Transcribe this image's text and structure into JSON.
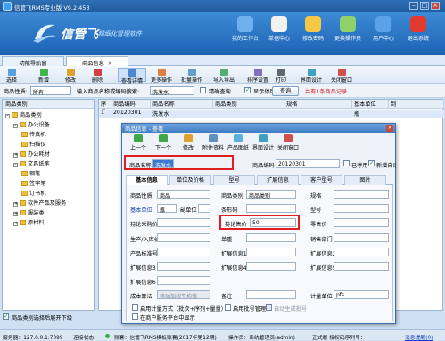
{
  "app": {
    "title": "信管飞RMS专业版 V9.2.453"
  },
  "banner": {
    "brand": "信管飞",
    "slogan": "精细化管理软件",
    "nav": [
      {
        "label": "我的工作台",
        "icon": "monitor-icon",
        "color": "#6fb1ee"
      },
      {
        "label": "单据中心",
        "icon": "document-center-icon",
        "color": "#f2f2f2"
      },
      {
        "label": "修改密码",
        "icon": "password-lock-icon",
        "color": "#f4c842"
      },
      {
        "label": "更换操作员",
        "icon": "switch-user-icon",
        "color": "#8fd16a"
      },
      {
        "label": "用户中心",
        "icon": "user-center-icon",
        "color": "#5aa2e8"
      },
      {
        "label": "退出系统",
        "icon": "power-icon",
        "color": "#e23b2e"
      }
    ]
  },
  "tabs": [
    {
      "label": "功能导航窗"
    },
    {
      "label": "商品信息"
    }
  ],
  "toolbar": [
    {
      "label": "选择",
      "icon": "select-icon",
      "color": "#58a0e0"
    },
    {
      "label": "新增",
      "icon": "add-icon",
      "color": "#3fb54a"
    },
    {
      "label": "修改",
      "icon": "edit-icon",
      "color": "#e0a030"
    },
    {
      "label": "删除",
      "icon": "delete-icon",
      "color": "#d04040"
    },
    {
      "label": "查看详情",
      "icon": "view-detail-icon",
      "color": "#4a88d0"
    },
    {
      "label": "更多操作",
      "icon": "more-actions-icon",
      "color": "#e08040"
    },
    {
      "label": "批量操作",
      "icon": "batch-icon",
      "color": "#60a0d0"
    },
    {
      "label": "导入导出",
      "icon": "import-export-icon",
      "color": "#50b070"
    },
    {
      "label": "排序设置",
      "icon": "sort-icon",
      "color": "#8070c0"
    },
    {
      "label": "打印",
      "icon": "print-icon",
      "color": "#606870"
    },
    {
      "label": "界面设计",
      "icon": "design-icon",
      "color": "#40a0c0"
    },
    {
      "label": "关闭窗口",
      "icon": "close-window-icon",
      "color": "#d05050"
    }
  ],
  "filter": {
    "field_label": "商品性质:",
    "field_value": "所有",
    "keyword_label": "输入商品名称或编码搜索:",
    "keyword_value": "洗发水",
    "fuzzy_label": "精确查询",
    "show_disabled_label": "显示停用商品",
    "query_button": "查询",
    "result_text": "共有1条商品记录"
  },
  "tree": {
    "header": "商品类别",
    "nodes": [
      {
        "label": "商品类别",
        "level": 0,
        "sign": "-"
      },
      {
        "label": "办公设备",
        "level": 1,
        "sign": "-"
      },
      {
        "label": "传真机",
        "level": 2,
        "sign": ""
      },
      {
        "label": "扫描仪",
        "level": 2,
        "sign": ""
      },
      {
        "label": "办公耗材",
        "level": 1,
        "sign": "+"
      },
      {
        "label": "文具纸笔",
        "level": 1,
        "sign": "-"
      },
      {
        "label": "钢笔",
        "level": 2,
        "sign": ""
      },
      {
        "label": "签字笔",
        "level": 2,
        "sign": ""
      },
      {
        "label": "订书机",
        "level": 2,
        "sign": ""
      },
      {
        "label": "软件产品及服务",
        "level": 1,
        "sign": "+"
      },
      {
        "label": "服装类",
        "level": 1,
        "sign": "+"
      },
      {
        "label": "原材料",
        "level": 1,
        "sign": "+"
      }
    ],
    "footer_checkbox": "商品类别选择后展开下级"
  },
  "grid": {
    "columns": [
      "序号",
      "商品编码",
      "商品名称",
      "商品类别",
      "规格",
      "基本单位",
      "到"
    ],
    "row": [
      "1",
      "20120301",
      "洗发水",
      "",
      "",
      "瓶",
      ""
    ]
  },
  "dialog": {
    "title": "商品信息 - 查看",
    "toolbar": [
      {
        "label": "上一个",
        "icon": "prev-icon",
        "color": "#3fa64a"
      },
      {
        "label": "下一个",
        "icon": "next-icon",
        "color": "#3fa64a"
      },
      {
        "label": "修改",
        "icon": "edit-icon",
        "color": "#e0a030"
      },
      {
        "label": "附件资料",
        "icon": "attachment-icon",
        "color": "#6090c0"
      },
      {
        "label": "产品图纸",
        "icon": "drawing-icon",
        "color": "#5ab0e0"
      },
      {
        "label": "界面设计",
        "icon": "design-icon",
        "color": "#40a0c0"
      },
      {
        "label": "关闭窗口",
        "icon": "close-window-icon",
        "color": "#d05050"
      }
    ],
    "name_label": "商品名称",
    "name_value": "洗发水",
    "code_label": "商品编码",
    "code_value": "20120301",
    "disabled_label": "已停用",
    "auto_code_label": "新增自动编码",
    "tabs": [
      "基本信息",
      "单位及价格",
      "型号",
      "扩展信息",
      "客户型号",
      "图片"
    ],
    "fields": {
      "nature_label": "商品性质",
      "nature_value": "商品",
      "category_label": "商品类别",
      "category_value": "商品类别",
      "spec_label": "规格",
      "base_unit_label": "基本单位",
      "base_unit_value": "瓶",
      "sub_unit_label": "副单位",
      "brand_label": "条形码",
      "model_label": "型号",
      "purchase_label": "持论采购价",
      "sale_label": "持论售价",
      "sale_value": "50",
      "retail_label": "零售价",
      "manufacturer_label": "生产/入库价",
      "unit_label": "单重",
      "sales_dept_label": "销售部门",
      "std_label": "产品标准号",
      "ext1_label": "扩展信息1",
      "ext2_label": "扩展信息2",
      "ext3_label": "扩展信息3",
      "ext4_label": "扩展信息4",
      "ext5_label": "扩展信息5",
      "ext6_label": "扩展信息6",
      "cost_label": "成本算法",
      "cost_value": "移动加权平均值",
      "remark_label": "备注",
      "unit2_label": "计量单位",
      "unit2_value": "pfs",
      "chk1": "启用计量方式（批次+序列+量量）",
      "chk2": "启用批号管理",
      "chk3": "自动生成批号",
      "chk4": "在商户服务平台中显示"
    }
  },
  "status": {
    "server": "服务器：127.0.0.1:7099",
    "conn": "连接状态：",
    "account": "账套：信管飞RMS模板账套(2017年第12期)",
    "operator": "操作员：系统管理员(admin)",
    "version": "正式版 授权码序列号：",
    "msg": "消息提醒(0)"
  }
}
